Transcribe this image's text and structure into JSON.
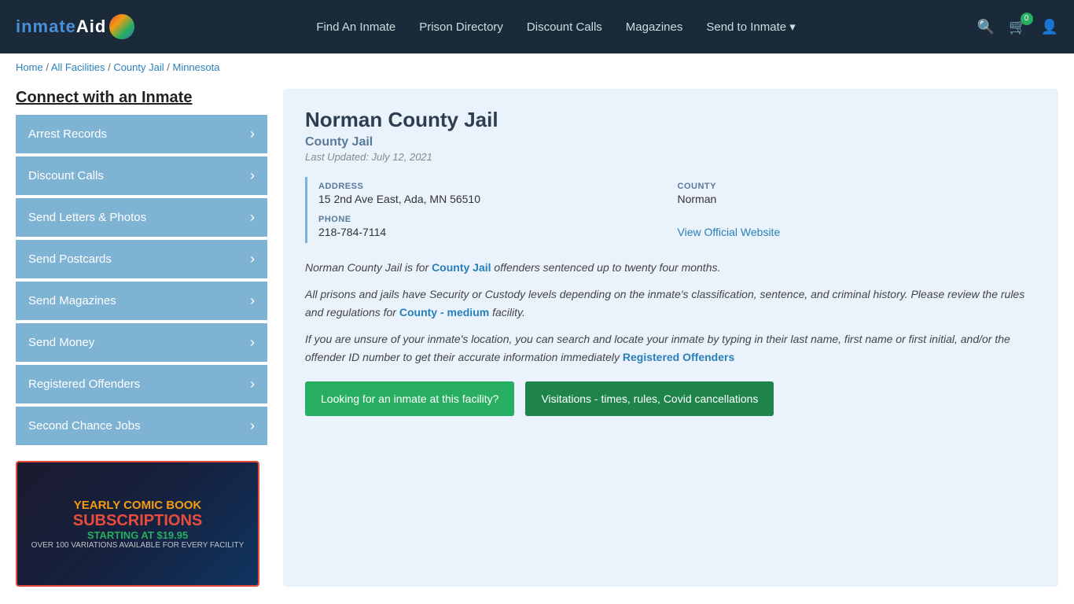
{
  "header": {
    "logo": {
      "inmate_text": "inmate",
      "aid_text": "Aid"
    },
    "nav": [
      {
        "label": "Find An Inmate",
        "id": "find-an-inmate"
      },
      {
        "label": "Prison Directory",
        "id": "prison-directory"
      },
      {
        "label": "Discount Calls",
        "id": "discount-calls"
      },
      {
        "label": "Magazines",
        "id": "magazines"
      },
      {
        "label": "Send to Inmate ▾",
        "id": "send-to-inmate"
      }
    ],
    "cart_count": "0",
    "icons": {
      "search": "🔍",
      "cart": "🛒",
      "user": "👤"
    }
  },
  "breadcrumb": {
    "items": [
      "Home",
      "All Facilities",
      "County Jail",
      "Minnesota"
    ],
    "separator": " / "
  },
  "sidebar": {
    "title": "Connect with an Inmate",
    "menu_items": [
      {
        "label": "Arrest Records",
        "id": "arrest-records"
      },
      {
        "label": "Discount Calls",
        "id": "discount-calls"
      },
      {
        "label": "Send Letters & Photos",
        "id": "send-letters-photos"
      },
      {
        "label": "Send Postcards",
        "id": "send-postcards"
      },
      {
        "label": "Send Magazines",
        "id": "send-magazines"
      },
      {
        "label": "Send Money",
        "id": "send-money"
      },
      {
        "label": "Registered Offenders",
        "id": "registered-offenders"
      },
      {
        "label": "Second Chance Jobs",
        "id": "second-chance-jobs"
      }
    ],
    "ad": {
      "line1": "YEARLY COMIC BOOK",
      "line2": "SUBSCRIPTIONS",
      "line3": "STARTING AT $19.95",
      "line4": "OVER 100 VARIATIONS AVAILABLE FOR EVERY FACILITY"
    }
  },
  "facility": {
    "name": "Norman County Jail",
    "type": "County Jail",
    "last_updated": "Last Updated: July 12, 2021",
    "address_label": "ADDRESS",
    "address_value": "15 2nd Ave East, Ada, MN 56510",
    "county_label": "COUNTY",
    "county_value": "Norman",
    "phone_label": "PHONE",
    "phone_value": "218-784-7114",
    "website_label": "View Official Website",
    "description1": "Norman County Jail is for ",
    "description1_link": "County Jail",
    "description1_rest": " offenders sentenced up to twenty four months.",
    "description2": "All prisons and jails have Security or Custody levels depending on the inmate's classification, sentence, and criminal history. Please review the rules and regulations for ",
    "description2_link": "County - medium",
    "description2_rest": " facility.",
    "description3": "If you are unsure of your inmate's location, you can search and locate your inmate by typing in their last name, first name or first initial, and/or the offender ID number to get their accurate information immediately ",
    "description3_link": "Registered Offenders",
    "btn1": "Looking for an inmate at this facility?",
    "btn2": "Visitations - times, rules, Covid cancellations"
  }
}
